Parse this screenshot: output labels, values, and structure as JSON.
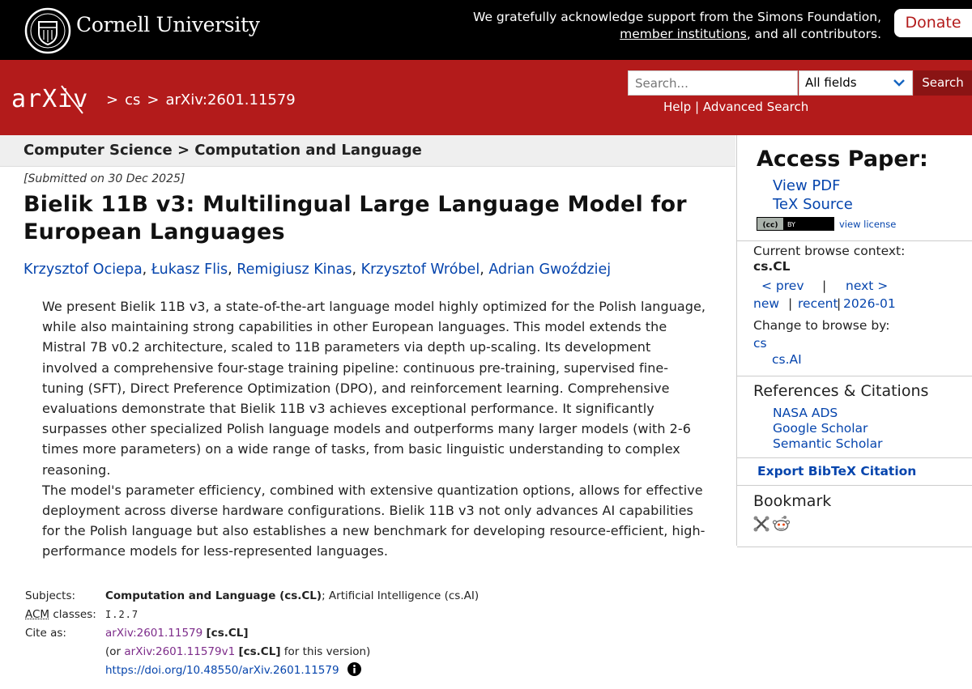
{
  "cornell": {
    "name": "Cornell University",
    "ack_line1": "We gratefully acknowledge support from the Simons Foundation,",
    "ack_link": "member institutions",
    "ack_line2_end": ", and all contributors.",
    "donate_label": "Donate"
  },
  "header": {
    "crumbs": [
      ">",
      "cs",
      ">",
      "arXiv:2601.11579"
    ],
    "search_placeholder": "Search...",
    "search_field": "All fields",
    "search_button": "Search",
    "help": "Help",
    "separator": "|",
    "advanced_search": "Advanced Search"
  },
  "subject_header": "Computer Science > Computation and Language",
  "submitted": "[Submitted on 30 Dec 2025]",
  "title": "Bielik 11B v3: Multilingual Large Language Model for European Languages",
  "authors": [
    "Krzysztof Ociepa",
    "Łukasz Flis",
    "Remigiusz Kinas",
    "Krzysztof Wróbel",
    "Adrian Gwoździej"
  ],
  "abstract": [
    "We present Bielik 11B v3, a state-of-the-art language model highly optimized for the Polish language, while also maintaining strong capabilities in other European languages. This model extends the Mistral 7B v0.2 architecture, scaled to 11B parameters via depth up-scaling. Its development involved a comprehensive four-stage training pipeline: continuous pre-training, supervised fine-tuning (SFT), Direct Preference Optimization (DPO), and reinforcement learning. Comprehensive evaluations demonstrate that Bielik 11B v3 achieves exceptional performance. It significantly surpasses other specialized Polish language models and outperforms many larger models (with 2-6 times more parameters) on a wide range of tasks, from basic linguistic understanding to complex reasoning.",
    "The model's parameter efficiency, combined with extensive quantization options, allows for effective deployment across diverse hardware configurations. Bielik 11B v3 not only advances AI capabilities for the Polish language but also establishes a new benchmark for developing resource-efficient, high-performance models for less-represented languages."
  ],
  "meta": {
    "subjects_label": "Subjects:",
    "subjects_primary": "Computation and Language (cs.CL)",
    "subjects_rest": "; Artificial Intelligence (cs.AI)",
    "acm_label_abbr": "ACM",
    "acm_label_rest": " classes:",
    "acm_value": "I.2.7",
    "cite_label": "Cite as:",
    "cite_id": "arXiv:2601.11579",
    "cite_cat": "[cs.CL]",
    "cite2_open": "(or ",
    "cite2_id": "arXiv:2601.11579v1",
    "cite2_cat": "[cs.CL]",
    "cite2_close": " for this version)",
    "doi": "https://doi.org/10.48550/arXiv.2601.11579"
  },
  "sidebar": {
    "access_title": "Access Paper:",
    "view_pdf": "View PDF",
    "tex_source": "TeX Source",
    "cc_badge": "(cc) BY",
    "view_license": "view license",
    "context_label": "Current browse context:",
    "context_value": "cs.CL",
    "prev": "< prev",
    "pipe": "|",
    "next": "next >",
    "new": "new",
    "recent": "recent",
    "month": "2026-01",
    "change_label": "Change to browse by:",
    "cs": "cs",
    "cs_ai": "cs.AI",
    "refs_title": "References & Citations",
    "nasa": "NASA ADS",
    "google": "Google Scholar",
    "semantic": "Semantic Scholar",
    "bibtex": "Export BibTeX Citation",
    "bookmark_title": "Bookmark"
  }
}
